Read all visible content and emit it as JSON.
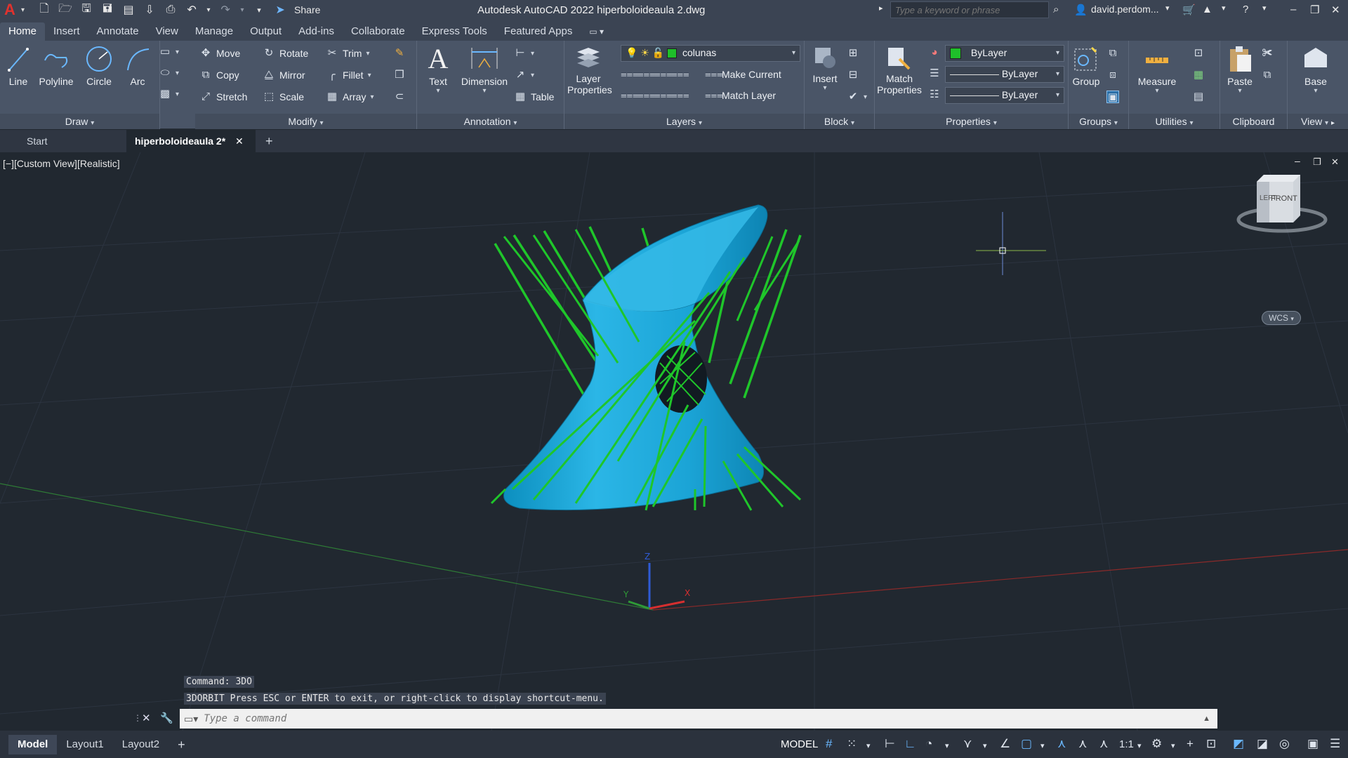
{
  "titlebar": {
    "logo": "A",
    "share_label": "Share",
    "title": "Autodesk AutoCAD 2022   hiperboloideaula 2.dwg",
    "search_placeholder": "Type a keyword or phrase",
    "user": "david.perdom...",
    "icons": [
      "new-icon",
      "open-icon",
      "save-icon",
      "save-as-icon",
      "plot-icon",
      "undo-icon",
      "redo-icon"
    ]
  },
  "ribbon_tabs": [
    "Home",
    "Insert",
    "Annotate",
    "View",
    "Manage",
    "Output",
    "Add-ins",
    "Collaborate",
    "Express Tools",
    "Featured Apps"
  ],
  "ribbon": {
    "draw": {
      "title": "Draw",
      "line": "Line",
      "polyline": "Polyline",
      "circle": "Circle",
      "arc": "Arc"
    },
    "modify": {
      "title": "Modify",
      "move": "Move",
      "rotate": "Rotate",
      "trim": "Trim",
      "copy": "Copy",
      "mirror": "Mirror",
      "fillet": "Fillet",
      "stretch": "Stretch",
      "scale": "Scale",
      "array": "Array"
    },
    "annotation": {
      "title": "Annotation",
      "text": "Text",
      "dimension": "Dimension",
      "table": "Table"
    },
    "layers": {
      "title": "Layers",
      "layer_properties_1": "Layer",
      "layer_properties_2": "Properties",
      "current_layer": "colunas",
      "make_current": "Make Current",
      "match_layer": "Match Layer",
      "layer_color": "#1fbf2a"
    },
    "block": {
      "title": "Block",
      "insert": "Insert"
    },
    "properties": {
      "title": "Properties",
      "match_1": "Match",
      "match_2": "Properties",
      "color": "ByLayer",
      "linetype": "ByLayer",
      "lineweight": "ByLayer"
    },
    "groups": {
      "title": "Groups",
      "group": "Group"
    },
    "utilities": {
      "title": "Utilities",
      "measure": "Measure"
    },
    "clipboard": {
      "title": "Clipboard",
      "paste": "Paste"
    },
    "view": {
      "title": "View",
      "base": "Base"
    }
  },
  "doc_tabs": {
    "start": "Start",
    "active": "hiperboloideaula 2*"
  },
  "viewport": {
    "label": "[−][Custom View][Realistic]",
    "viewcube_left": "LEFT",
    "viewcube_front": "FRONT",
    "wcs": "WCS"
  },
  "command": {
    "history_1": "Command: 3DO",
    "history_2": "3DORBIT Press ESC or ENTER to exit, or right-click to display shortcut-menu.",
    "placeholder": "Type a command"
  },
  "status": {
    "layout_tabs": [
      "Model",
      "Layout1",
      "Layout2"
    ],
    "model": "MODEL",
    "scale": "1:1"
  }
}
